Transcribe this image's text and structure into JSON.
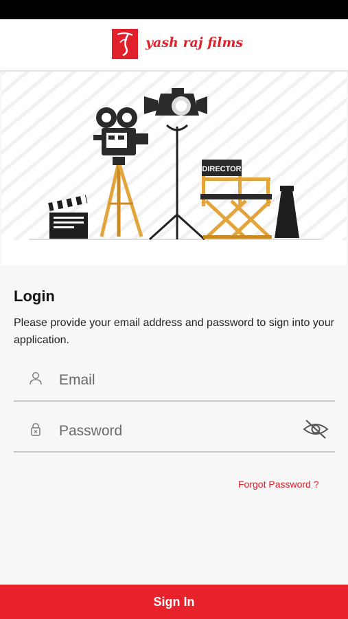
{
  "header": {
    "logo_text": "yash raj films",
    "logo_icon": "yrf-logo-icon"
  },
  "hero": {
    "illustration": "film-set-illustration",
    "chair_label": "DIRECTOR"
  },
  "login": {
    "title": "Login",
    "description": "Please provide your email address and password to sign into your application.",
    "email": {
      "placeholder": "Email",
      "value": "",
      "icon": "user-icon"
    },
    "password": {
      "placeholder": "Password",
      "value": "",
      "icon": "lock-icon",
      "toggle_icon": "eye-off-icon"
    },
    "forgot_label": "Forgot Password ?",
    "signin_label": "Sign In"
  },
  "colors": {
    "accent": "#e8222b",
    "background": "#f7f7f7",
    "status_bar": "#000000"
  }
}
